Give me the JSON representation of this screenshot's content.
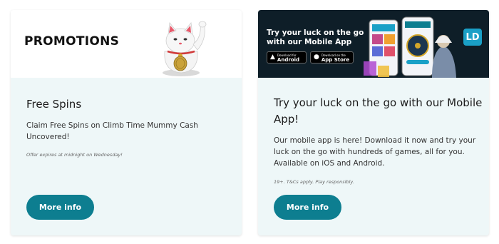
{
  "promotions": {
    "banner_title": "PROMOTIONS",
    "title": "Free Spins",
    "description": "Claim Free Spins on Climb Time Mummy Cash Uncovered!",
    "note": "Offer expires at midnight on Wednesday!",
    "button_label": "More info"
  },
  "mobile_app": {
    "banner_heading_line1": "Try your luck on the go",
    "banner_heading_line2": "with our Mobile App",
    "android": {
      "small": "Download for",
      "big": "Android"
    },
    "apple": {
      "small": "Download on the",
      "big": "App Store"
    },
    "badge": "LD",
    "title": "Try your luck on the go with our Mobile App!",
    "description": "Our mobile app is here! Download it now and try your luck on the go with hundreds of games, all for you. Available on iOS and Android.",
    "note": "19+. T&Cs apply. Play responsibly.",
    "button_label": "More info"
  },
  "colors": {
    "card_bg": "#eef7f8",
    "button": "#0d7e90",
    "app_banner_bg": "#0e1e28",
    "badge": "#1aa0c7"
  },
  "icons": [
    "lucky-cat-illustration",
    "android-icon",
    "apple-icon",
    "phones-illustration"
  ]
}
